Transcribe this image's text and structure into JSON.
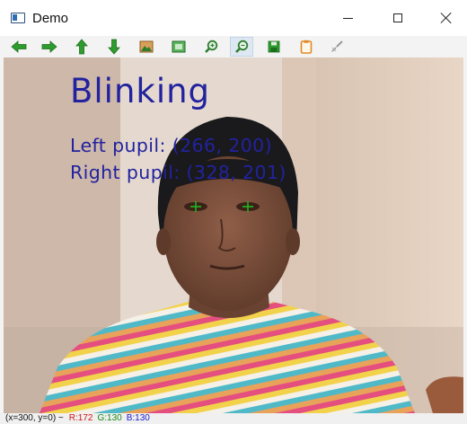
{
  "window": {
    "title": "Demo",
    "buttons": {
      "minimize": "minimize",
      "maximize": "maximize",
      "close": "close"
    }
  },
  "toolbar": {
    "items": [
      {
        "name": "pan-left",
        "icon": "arrow-left-icon",
        "color": "#2e9b2e"
      },
      {
        "name": "pan-right",
        "icon": "arrow-right-icon",
        "color": "#2e9b2e"
      },
      {
        "name": "pan-up",
        "icon": "arrow-up-icon",
        "color": "#2e9b2e"
      },
      {
        "name": "pan-down",
        "icon": "arrow-down-icon",
        "color": "#2e9b2e"
      },
      {
        "name": "zoom-fit",
        "icon": "image-icon",
        "color": "#c97d2c"
      },
      {
        "name": "zoom-actual",
        "icon": "image-frame-icon",
        "color": "#2e9b2e"
      },
      {
        "name": "zoom-in",
        "icon": "magnifier-plus-icon",
        "color": "#2e7d2e"
      },
      {
        "name": "zoom-out",
        "icon": "magnifier-minus-icon",
        "color": "#2e7d2e"
      },
      {
        "name": "save",
        "icon": "save-icon",
        "color": "#2e9b2e"
      },
      {
        "name": "properties",
        "icon": "clipboard-icon",
        "color": "#e08a2a"
      },
      {
        "name": "settings",
        "icon": "brush-icon",
        "color": "#9a9a9a"
      }
    ]
  },
  "overlay": {
    "status": "Blinking",
    "left_pupil": "Left pupil:  (266, 200)",
    "right_pupil": "Right pupil:  (328, 201)"
  },
  "statusbar": {
    "position": "(x=300, y=0) ~",
    "r": "R:172",
    "g": "G:130",
    "b": "B:130"
  },
  "colors": {
    "overlay_text": "#22229e",
    "pupil_marker": "#20c020",
    "r_text": "#d01818",
    "g_text": "#1a8a1a",
    "b_text": "#1a1ad0"
  }
}
